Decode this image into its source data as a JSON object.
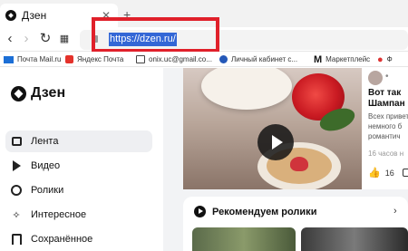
{
  "browser": {
    "tab": {
      "title": "Дзен",
      "close_glyph": "✕"
    },
    "new_tab_glyph": "+",
    "nav": {
      "back_glyph": "‹",
      "forward_glyph": "›",
      "reload_glyph": "↻",
      "grid_glyph": "▦"
    },
    "address": {
      "url": "https://dzen.ru/"
    },
    "highlight_color": "#e0202a",
    "bookmarks": [
      {
        "label": "Почта Mail.ru",
        "icon": "mail-icon"
      },
      {
        "label": "Яндекс Почта",
        "icon": "yandex-mail-icon"
      },
      {
        "label": "onix.uc@gmail.co...",
        "icon": "gmail-icon"
      },
      {
        "label": "Личный кабинет с...",
        "icon": "account-icon"
      },
      {
        "label": "Маркетплейс",
        "icon": "m-logo-icon"
      },
      {
        "label": "Ф",
        "icon": "pin-icon"
      }
    ]
  },
  "sidebar": {
    "brand": "Дзен",
    "items": [
      {
        "label": "Лента",
        "icon": "feed-icon"
      },
      {
        "label": "Видео",
        "icon": "video-icon"
      },
      {
        "label": "Ролики",
        "icon": "clips-icon"
      },
      {
        "label": "Интересное",
        "icon": "interesting-icon"
      },
      {
        "label": "Сохранённое",
        "icon": "saved-icon"
      }
    ]
  },
  "feed": {
    "post": {
      "title_line1": "Вот так",
      "title_line2": "Шампан",
      "desc_line1": "Всех привет",
      "desc_line2": "немного б",
      "desc_line3": "романтич",
      "date": "16 часов н",
      "likes": "16",
      "channel_dots": "•"
    },
    "recommended": {
      "title": "Рекомендуем ролики",
      "chevron": "›"
    }
  }
}
